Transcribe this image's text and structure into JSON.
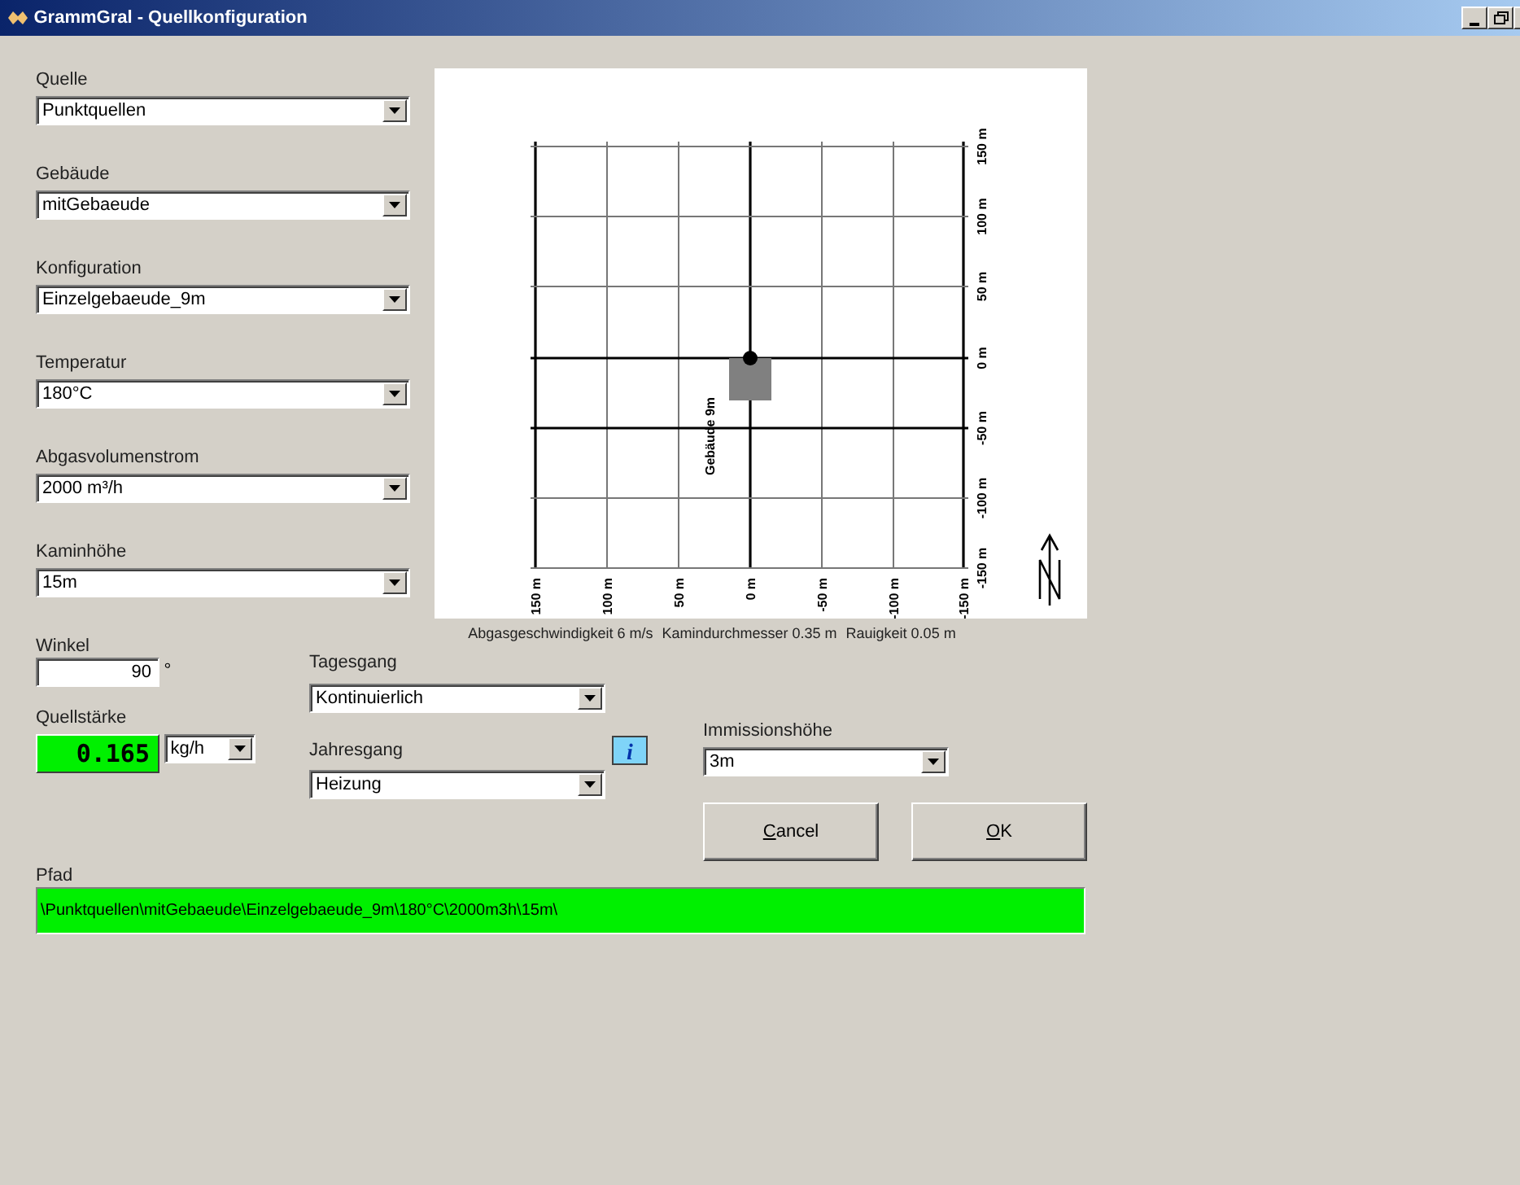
{
  "window": {
    "title": "GrammGral - Quellkonfiguration"
  },
  "fields": [
    {
      "label": "Quelle",
      "value": "Punktquellen"
    },
    {
      "label": "Gebäude",
      "value": "mitGebaeude"
    },
    {
      "label": "Konfiguration",
      "value": "Einzelgebaeude_9m"
    },
    {
      "label": "Temperatur",
      "value": "180°C"
    },
    {
      "label": "Abgasvolumenstrom",
      "value": "2000 m³/h"
    },
    {
      "label": "Kaminhöhe",
      "value": "15m"
    }
  ],
  "diagram": {
    "x_labels": [
      "150 m",
      "100 m",
      "50 m",
      "0 m",
      "-50 m",
      "-100 m",
      "-150 m"
    ],
    "y_labels": [
      "150 m",
      "100 m",
      "50 m",
      "0 m",
      "-50 m",
      "-100 m",
      "-150 m"
    ],
    "building_label": "Gebäude 9m"
  },
  "parameters": [
    "Abgasgeschwindigkeit 6 m/s",
    "Kamindurchmesser 0.35 m",
    "Rauigkeit 0.05 m"
  ],
  "winkel": {
    "label": "Winkel",
    "value": "90",
    "unit": "°"
  },
  "quellstaerke": {
    "label": "Quellstärke",
    "value": "0.165",
    "unit": "kg/h"
  },
  "tagesgang": {
    "label": "Tagesgang",
    "value": "Kontinuierlich"
  },
  "jahresgang": {
    "label": "Jahresgang",
    "value": "Heizung"
  },
  "immissionshoehe": {
    "label": "Immissionshöhe",
    "value": "3m"
  },
  "info_button": {
    "label": "i"
  },
  "buttons": [
    {
      "label": "Cancel"
    },
    {
      "label": "OK"
    }
  ],
  "pfad": {
    "label": "Pfad",
    "value": "\\Punktquellen\\mitGebaeude\\Einzelgebaeude_9m\\180°C\\2000m3h\\15m\\"
  }
}
